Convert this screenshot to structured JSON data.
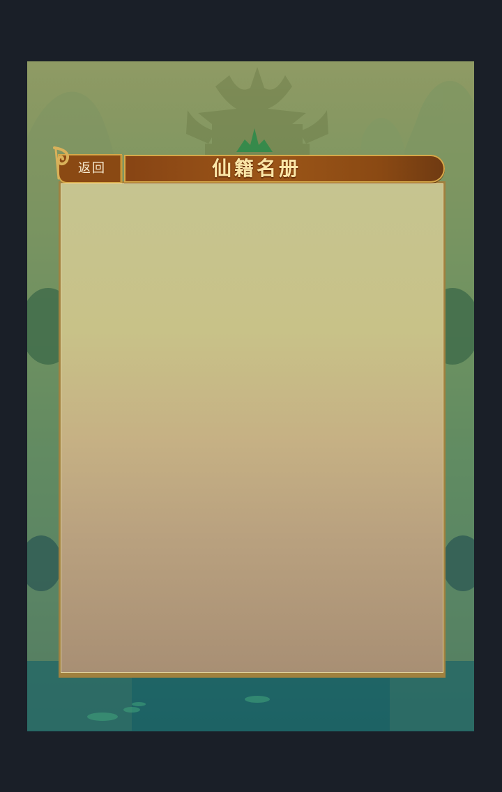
{
  "screen": {
    "title": "仙籍名册",
    "back_label": "返回"
  },
  "colors": {
    "page_background": "#1a1f28",
    "title_bar": "#8f4e17",
    "title_text": "#fbe6a8",
    "panel_background": "#c6c490",
    "panel_border": "#a0813f"
  },
  "icons": {
    "back": "scroll-curl-icon"
  },
  "content": {
    "items": []
  }
}
